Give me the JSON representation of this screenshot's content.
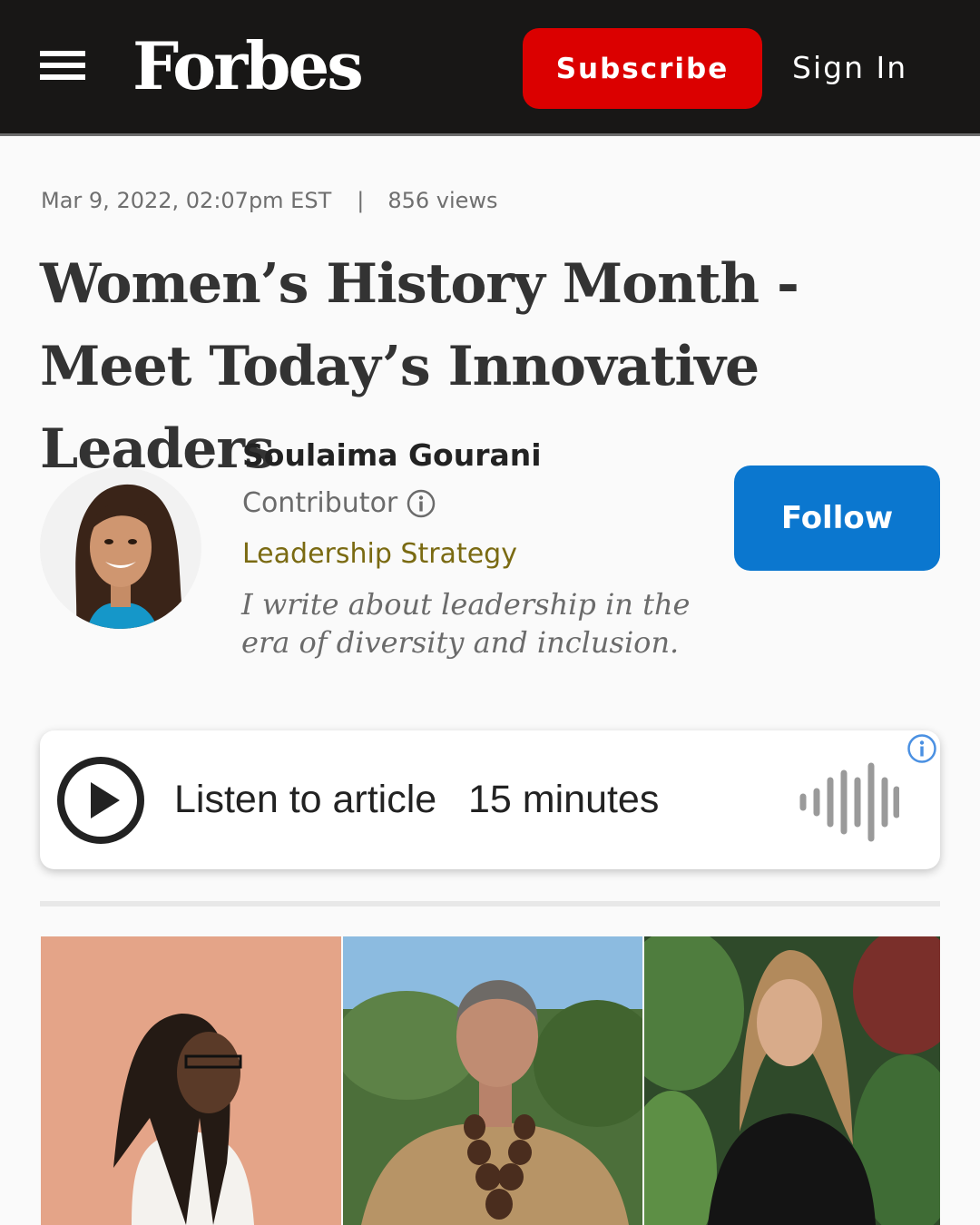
{
  "header": {
    "logo": "Forbes",
    "subscribe_label": "Subscribe",
    "signin_label": "Sign In",
    "colors": {
      "background": "#181716",
      "subscribe": "#db0000"
    }
  },
  "article": {
    "date": "Mar 9, 2022, 02:07pm EST",
    "separator": "|",
    "views": "856 views",
    "title": "Women’s History Month - Meet Today’s Innovative Leaders"
  },
  "author": {
    "name": "Soulaima Gourani",
    "role": "Contributor",
    "channel": "Leadership Strategy",
    "bio": "I write about leadership in the era of diversity and inclusion.",
    "follow_label": "Follow",
    "colors": {
      "follow": "#0b77cf",
      "channel": "#7a6a12"
    }
  },
  "audio": {
    "label": "Listen to article",
    "duration": "15 minutes",
    "icons": [
      "play-icon",
      "waveform-icon",
      "info-icon"
    ]
  },
  "gallery": {
    "icons": [
      "photo-woman-braids",
      "photo-woman-necklace",
      "photo-woman-garden"
    ]
  }
}
